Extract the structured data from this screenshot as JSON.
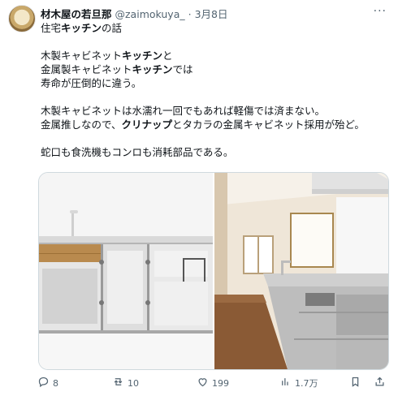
{
  "tweet": {
    "author_name": "材木屋の若旦那",
    "handle": "@zaimokuya_",
    "separator": "·",
    "date": "3月8日",
    "more": "···",
    "lines": [
      {
        "parts": [
          {
            "t": "住宅",
            "b": false
          },
          {
            "t": "キッチン",
            "b": true
          },
          {
            "t": "の話",
            "b": false
          }
        ]
      },
      null,
      {
        "parts": [
          {
            "t": "木製キャビネット",
            "b": false
          },
          {
            "t": "キッチン",
            "b": true
          },
          {
            "t": "と",
            "b": false
          }
        ]
      },
      {
        "parts": [
          {
            "t": "金属製キャビネット",
            "b": false
          },
          {
            "t": "キッチン",
            "b": true
          },
          {
            "t": "では",
            "b": false
          }
        ]
      },
      {
        "parts": [
          {
            "t": "寿命が圧倒的に違う。",
            "b": false
          }
        ]
      },
      null,
      {
        "parts": [
          {
            "t": "木製キャビネットは水濡れ一回でもあれば軽傷では済まない。",
            "b": false
          }
        ]
      },
      {
        "parts": [
          {
            "t": "金属推しなので、",
            "b": false
          },
          {
            "t": "クリナップ",
            "b": true
          },
          {
            "t": "とタカラの金属キャビネット採用が殆ど。",
            "b": false
          }
        ]
      },
      null,
      {
        "parts": [
          {
            "t": "蛇口も食洗機もコンロも消耗部品である。",
            "b": false
          }
        ]
      }
    ]
  },
  "actions": {
    "reply_count": "8",
    "retweet_count": "10",
    "like_count": "199",
    "view_count": "1.7万"
  }
}
